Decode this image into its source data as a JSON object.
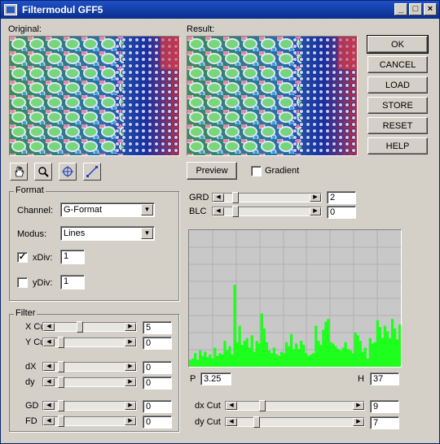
{
  "window": {
    "title": "Filtermodul GFF5",
    "buttons": [
      "_",
      "□",
      "×"
    ]
  },
  "original_label": "Original:",
  "result_label": "Result:",
  "side_buttons": [
    "OK",
    "CANCEL",
    "LOAD",
    "STORE",
    "RESET",
    "HELP"
  ],
  "tools": [
    "hand-icon",
    "zoom-icon",
    "crosshair-icon",
    "line-icon"
  ],
  "preview_label": "Preview",
  "gradient_label": "Gradient",
  "grd": {
    "label": "GRD",
    "value": "2",
    "level": 0.1
  },
  "blc": {
    "label": "BLC",
    "value": "0",
    "level": 0.1
  },
  "format": {
    "title": "Format",
    "channel_label": "Channel:",
    "channel_value": "G-Format",
    "modus_label": "Modus:",
    "modus_value": "Lines",
    "xdiv_label": "xDiv:",
    "xdiv_value": "1",
    "xdiv_checked": true,
    "ydiv_label": "yDiv:",
    "ydiv_value": "1",
    "ydiv_checked": false
  },
  "filter": {
    "title": "Filter",
    "rows": [
      {
        "label": "X Cut",
        "value": "5",
        "level": 0.35
      },
      {
        "label": "Y Cut",
        "value": "0",
        "level": 0.05
      },
      {
        "label": "dX",
        "value": "0",
        "level": 0.05
      },
      {
        "label": "dy",
        "value": "0",
        "level": 0.05
      },
      {
        "label": "GD",
        "value": "0",
        "level": 0.05
      },
      {
        "label": "FD",
        "value": "0",
        "level": 0.05
      }
    ]
  },
  "histogram": {
    "p_label": "P",
    "p_value": "3.25",
    "h_label": "H",
    "h_value": "37",
    "bar_color": "#1eff1e",
    "values": [
      5,
      6,
      10,
      5,
      12,
      8,
      11,
      7,
      9,
      6,
      14,
      8,
      10,
      9,
      19,
      12,
      15,
      9,
      60,
      18,
      30,
      16,
      19,
      21,
      14,
      23,
      11,
      19,
      17,
      39,
      28,
      18,
      12,
      10,
      14,
      9,
      8,
      11,
      10,
      18,
      15,
      24,
      13,
      17,
      13,
      19,
      16,
      10,
      8,
      9,
      10,
      30,
      19,
      16,
      27,
      33,
      35,
      18,
      17,
      15,
      13,
      12,
      14,
      18,
      13,
      12,
      10,
      25,
      23,
      19,
      11,
      14,
      6,
      21,
      17,
      18,
      34,
      29,
      21,
      30,
      26,
      21,
      35,
      28,
      20,
      31
    ]
  },
  "dxcut": {
    "label": "dx Cut",
    "value": "9",
    "level": 0.2
  },
  "dycut": {
    "label": "dy Cut",
    "value": "7",
    "level": 0.15
  }
}
